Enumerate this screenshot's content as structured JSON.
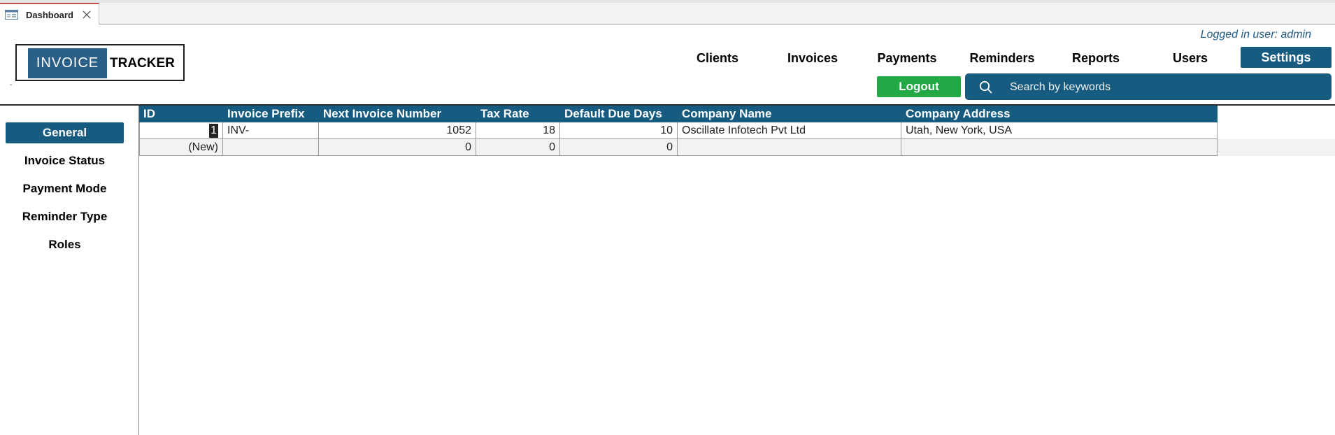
{
  "tab": {
    "label": "Dashboard"
  },
  "logo": {
    "left": "INVOICE",
    "right": "TRACKER"
  },
  "dot_mark": "-",
  "user": {
    "logged_in_text": "Logged in user: admin"
  },
  "nav": {
    "items": [
      {
        "label": "Clients"
      },
      {
        "label": "Invoices"
      },
      {
        "label": "Payments"
      },
      {
        "label": "Reminders"
      },
      {
        "label": "Reports"
      },
      {
        "label": "Users"
      }
    ],
    "active": {
      "label": "Settings"
    }
  },
  "logout": {
    "label": "Logout"
  },
  "search": {
    "placeholder": "Search by keywords"
  },
  "sidebar": {
    "items": [
      {
        "label": "General",
        "active": true
      },
      {
        "label": "Invoice Status"
      },
      {
        "label": "Payment Mode"
      },
      {
        "label": "Reminder Type"
      },
      {
        "label": "Roles"
      }
    ]
  },
  "table": {
    "columns": [
      "ID",
      "Invoice Prefix",
      "Next Invoice Number",
      "Tax Rate",
      "Default Due Days",
      "Company Name",
      "Company Address"
    ],
    "rows": [
      {
        "id": "1",
        "prefix": "INV-",
        "next_number": "1052",
        "tax_rate": "18",
        "due_days": "10",
        "company_name": "Oscillate Infotech Pvt Ltd",
        "company_address": "Utah, New York, USA"
      }
    ],
    "new_row": {
      "id": "(New)",
      "prefix": "",
      "next_number": "0",
      "tax_rate": "0",
      "due_days": "0",
      "company_name": "",
      "company_address": ""
    }
  },
  "colors": {
    "primary": "#175b80",
    "logout": "#21a946",
    "logo_block": "#2a5f88",
    "tab_accent": "#c0504d"
  }
}
